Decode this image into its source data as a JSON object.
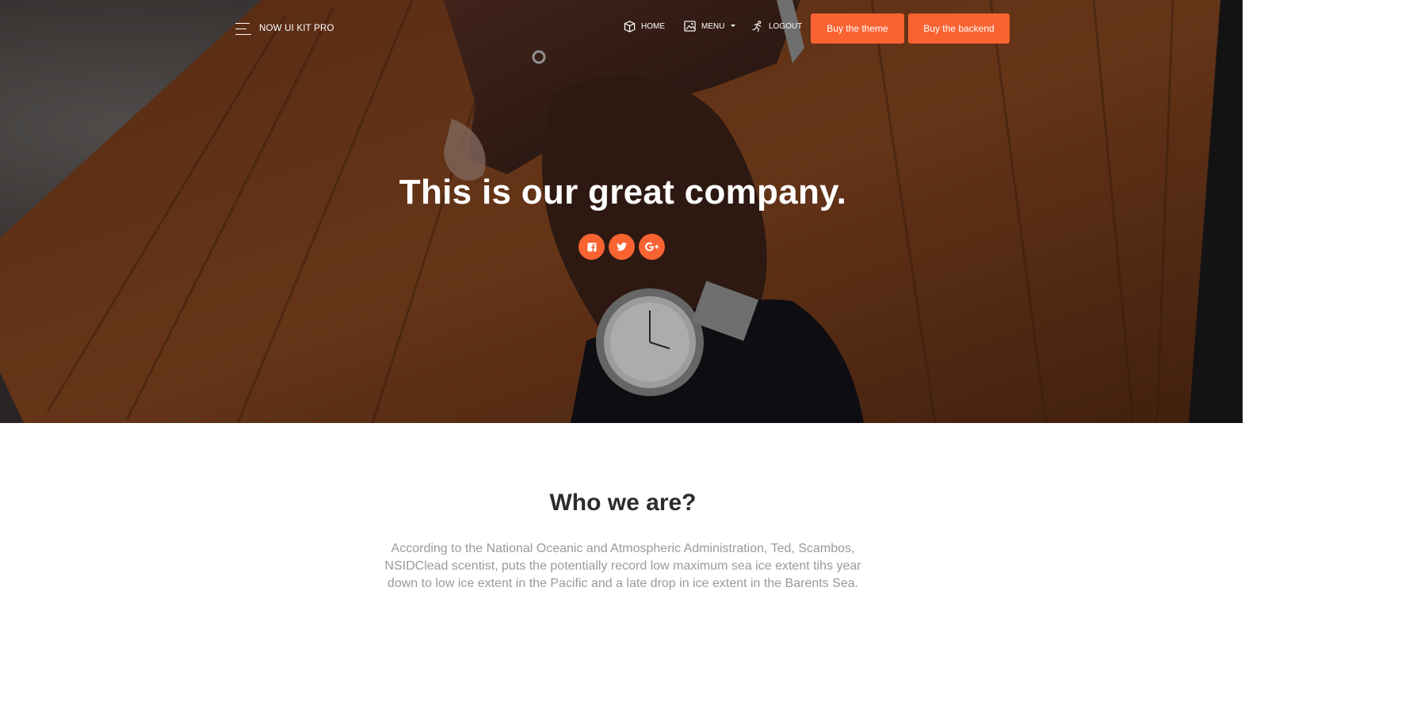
{
  "navbar": {
    "brand": "NOW UI KIT PRO",
    "items": [
      {
        "label": "HOME",
        "icon": "box-icon"
      },
      {
        "label": "MENU",
        "icon": "image-icon"
      },
      {
        "label": "LOGOUT",
        "icon": "runner-icon"
      }
    ],
    "buttons": [
      "Buy the theme",
      "Buy the backend"
    ]
  },
  "hero": {
    "title": "This is our great company.",
    "socials": [
      "facebook-icon",
      "twitter-icon",
      "google-plus-icon"
    ]
  },
  "about": {
    "title": "Who we are?",
    "description": "According to the National Oceanic and Atmospheric Administration, Ted, Scambos, NSIDClead scentist, puts the potentially record low maximum sea ice extent tihs year down to low ice extent in the Pacific and a late drop in ice extent in the Barents Sea."
  },
  "colors": {
    "accent": "#f96332",
    "heading": "#2c2c2c",
    "muted_text": "#9a9a9a"
  }
}
